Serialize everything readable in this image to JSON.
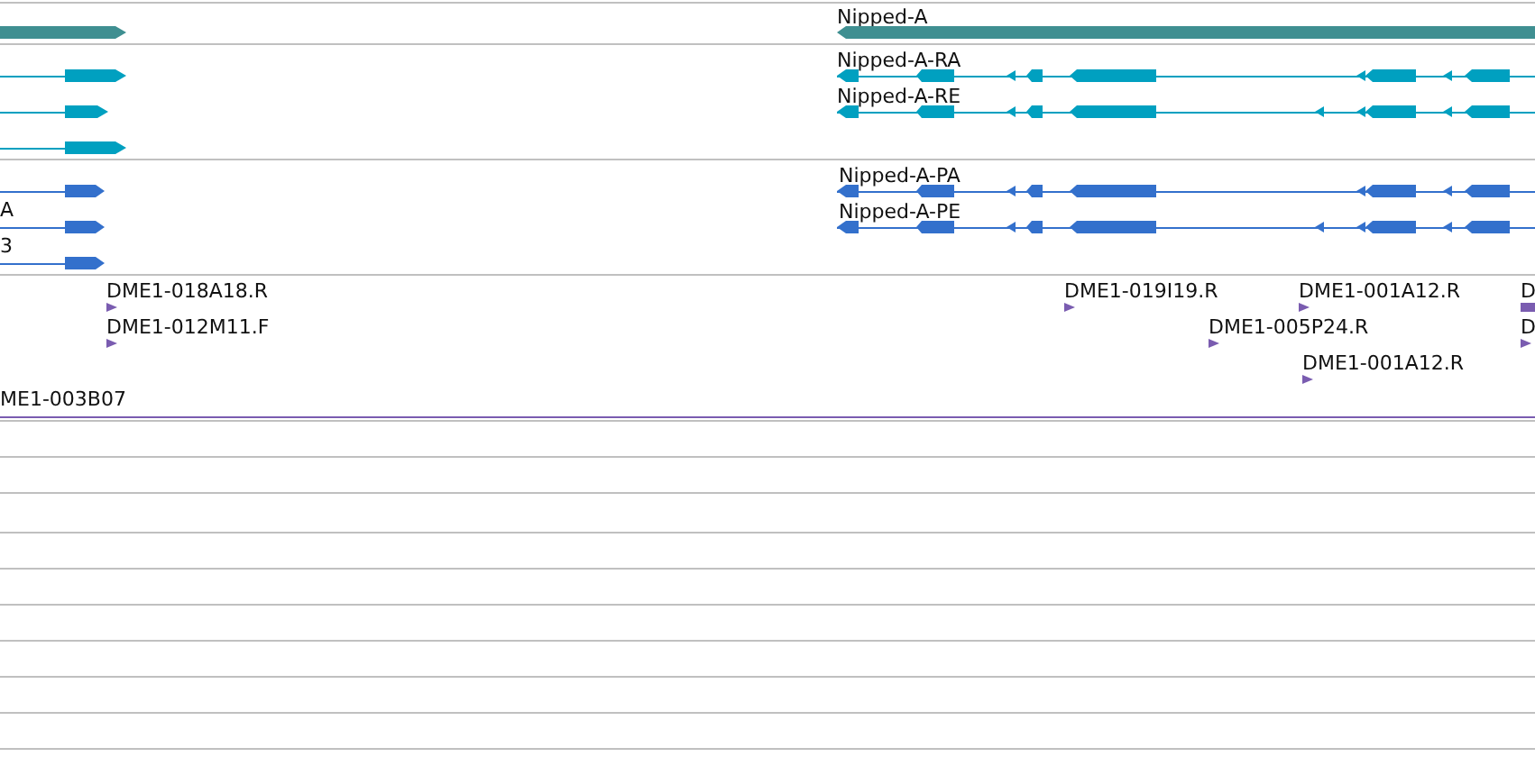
{
  "tracks": [
    {
      "kind": "gene",
      "color": "#3f8f91",
      "labels": [
        "Nipped-A"
      ]
    },
    {
      "kind": "transcript",
      "color": "#00a0c0",
      "labels": [
        "Nipped-A-RA",
        "Nipped-A-RE"
      ]
    },
    {
      "kind": "protein",
      "color": "#3370cc",
      "labels": [
        "A",
        "3",
        "Nipped-A-PA",
        "Nipped-A-PE"
      ]
    },
    {
      "kind": "clone",
      "color": "#7a5cb0",
      "labels": [
        "DME1-018A18.R",
        "DME1-012M11.F",
        "ME1-003B07",
        "DME1-019I19.R",
        "DME1-001A12.R",
        "DME1-005P24.R",
        "DME1-001A12.R",
        "D",
        "D"
      ]
    }
  ]
}
